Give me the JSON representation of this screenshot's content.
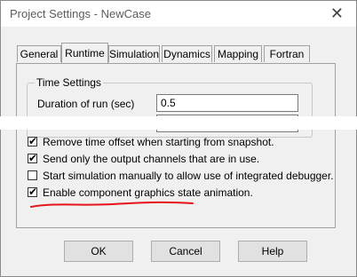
{
  "window": {
    "title": "Project Settings - NewCase",
    "close_glyph": "✕"
  },
  "tabs": [
    {
      "label": "General"
    },
    {
      "label": "Runtime",
      "active": true
    },
    {
      "label": "Simulation"
    },
    {
      "label": "Dynamics"
    },
    {
      "label": "Mapping"
    },
    {
      "label": "Fortran"
    }
  ],
  "time_settings": {
    "group_label": "Time Settings",
    "duration_label": "Duration of run (sec)",
    "duration_value": "0.5"
  },
  "checkboxes": [
    {
      "label": "Remove time offset when starting from snapshot.",
      "checked": true
    },
    {
      "label": "Send only the output channels that are in use.",
      "checked": true
    },
    {
      "label": "Start simulation manually to allow use of integrated debugger.",
      "checked": false
    },
    {
      "label": "Enable component graphics state animation.",
      "checked": true
    }
  ],
  "annotation": {
    "underline_color": "#e8121c"
  },
  "buttons": {
    "ok": "OK",
    "cancel": "Cancel",
    "help": "Help"
  },
  "check_glyph": "✔"
}
